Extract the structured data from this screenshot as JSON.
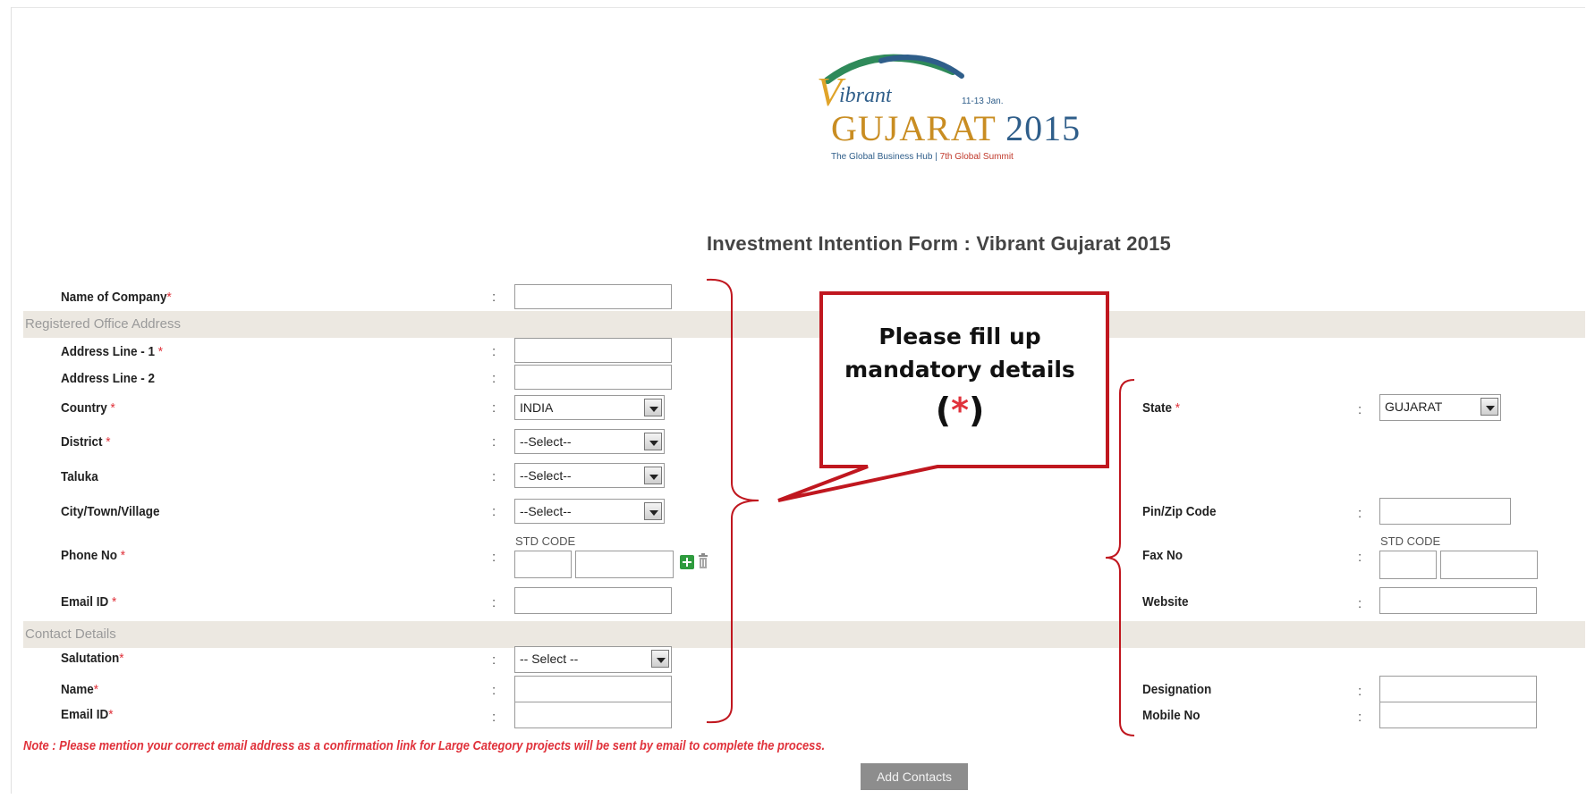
{
  "logo": {
    "brand_top": "ibrant",
    "brand_v": "V",
    "dates": "11-13 Jan.",
    "name": "GUJARAT",
    "year": "2015",
    "tagline": "The Global Business Hub",
    "tagline_summit": "7th Global Summit"
  },
  "form_title": "Investment Intention Form : Vibrant Gujarat 2015",
  "separator": ":",
  "required_mark": "*",
  "sections": {
    "registered_office": "Registered Office Address",
    "contact_details": "Contact Details"
  },
  "labels": {
    "company_name": "Name of Company",
    "address1": "Address Line - 1",
    "address2": "Address Line - 2",
    "country": "Country",
    "district": "District",
    "taluka": "Taluka",
    "city": "City/Town/Village",
    "phone": "Phone No",
    "email": "Email ID",
    "salutation": "Salutation",
    "name": "Name",
    "contact_email": "Email ID",
    "state": "State",
    "pin": "Pin/Zip Code",
    "fax": "Fax No",
    "website": "Website",
    "designation": "Designation",
    "mobile": "Mobile No"
  },
  "selects": {
    "country": "INDIA",
    "district": "--Select--",
    "taluka": "--Select--",
    "city": "--Select--",
    "salutation": "-- Select --",
    "state": "GUJARAT"
  },
  "std_code_label": "STD CODE",
  "note": "Note : Please mention your correct email address as a confirmation link for Large Category projects will be sent by email to complete the process.",
  "add_contacts": "Add Contacts",
  "callout": {
    "line1": "Please fill up",
    "line2": "mandatory  details",
    "open": "(",
    "star": "*",
    "close": ")"
  },
  "colors": {
    "required": "#e0323b",
    "callout_border": "#c0171f",
    "section_bar": "#ece8e1",
    "button": "#8d8d8d"
  }
}
